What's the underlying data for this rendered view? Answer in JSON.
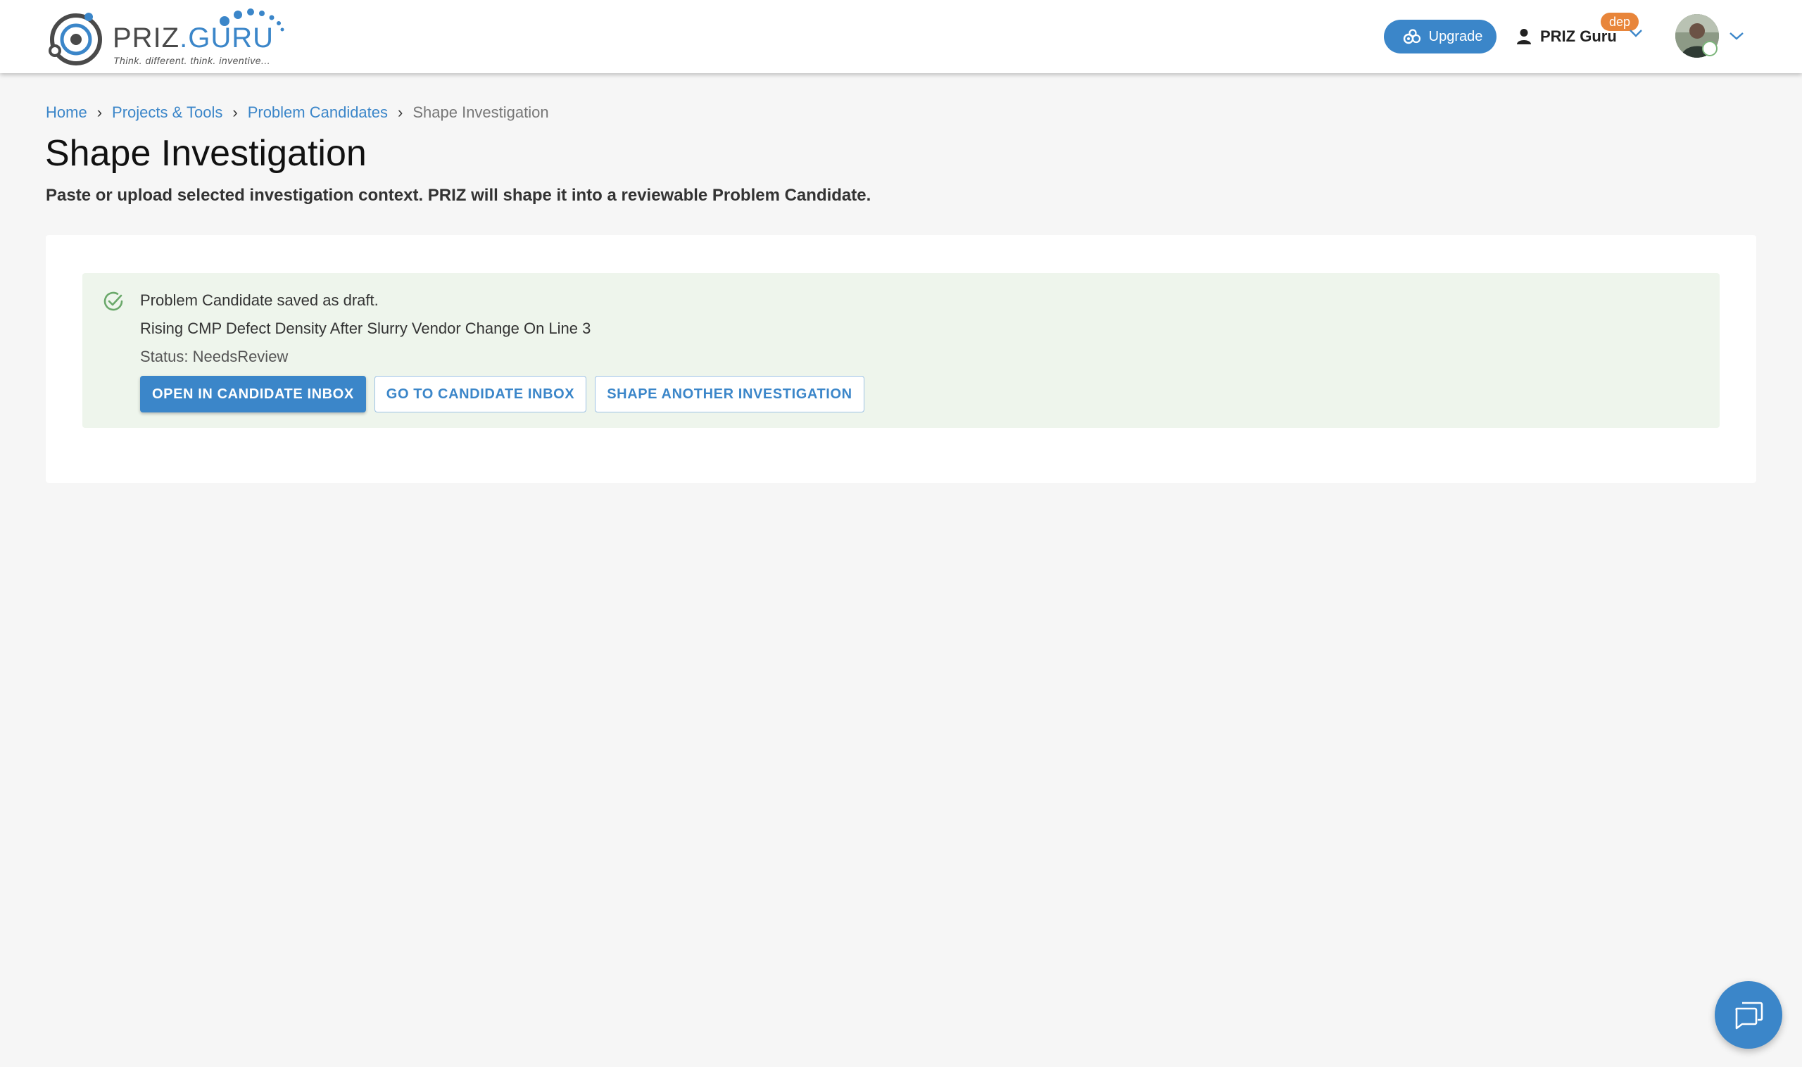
{
  "header": {
    "logo": {
      "word_priz": "PRIZ",
      "word_dot": ".",
      "word_guru": "GURU",
      "tagline": "Think. different. think. inventive..."
    },
    "upgrade_label": "Upgrade",
    "user_name": "PRIZ Guru",
    "user_badge": "dep"
  },
  "breadcrumb": {
    "items": [
      {
        "label": "Home",
        "link": true
      },
      {
        "label": "Projects & Tools",
        "link": true
      },
      {
        "label": "Problem Candidates",
        "link": true
      },
      {
        "label": "Shape Investigation",
        "link": false
      }
    ]
  },
  "page": {
    "title": "Shape Investigation",
    "subtitle": "Paste or upload selected investigation context. PRIZ will shape it into a reviewable Problem Candidate."
  },
  "alert": {
    "message": "Problem Candidate saved as draft.",
    "candidate_title": "Rising CMP Defect Density After Slurry Vendor Change On Line 3",
    "status": "Status: NeedsReview",
    "actions": {
      "open_label": "OPEN IN CANDIDATE INBOX",
      "goto_label": "GO TO CANDIDATE INBOX",
      "shape_another_label": "SHAPE ANOTHER INVESTIGATION"
    }
  },
  "colors": {
    "accent": "#3b86c9",
    "badge": "#e8853a",
    "success_bg": "#eef5ec",
    "success_icon": "#6aa86a"
  },
  "icons": {
    "upgrade": "cogs-icon",
    "user": "person-icon",
    "success": "check-circle-icon",
    "chat": "chat-bubbles-icon"
  }
}
